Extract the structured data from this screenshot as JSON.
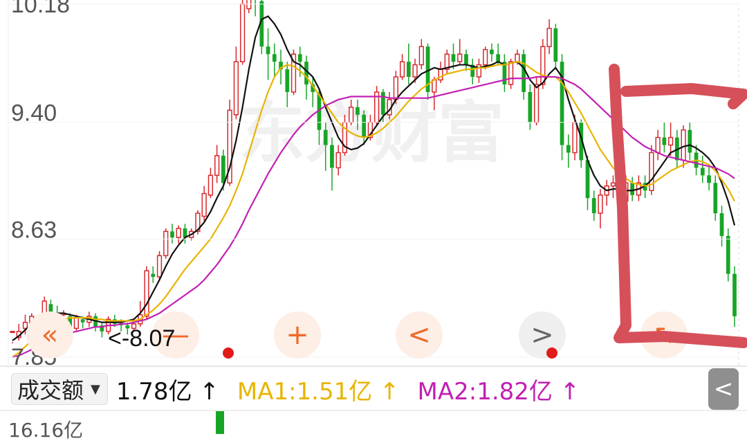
{
  "chart_data": {
    "type": "candlestick",
    "yticks": [
      "10.18",
      "9.40",
      "8.63",
      "7.85"
    ],
    "ylim": [
      7.85,
      10.18
    ],
    "watermark": "东方财富",
    "candles": [
      [
        8.02,
        8.02,
        7.95,
        7.94
      ],
      [
        7.98,
        8.02,
        8.07,
        7.96
      ],
      [
        8.04,
        8.08,
        8.13,
        8.0
      ],
      [
        8.06,
        8.12,
        8.14,
        8.02
      ],
      [
        8.04,
        8.03,
        8.13,
        8.0
      ],
      [
        8.1,
        8.22,
        8.25,
        8.08
      ],
      [
        8.2,
        8.14,
        8.23,
        8.1
      ],
      [
        8.13,
        8.12,
        8.19,
        8.08
      ],
      [
        8.13,
        8.14,
        8.16,
        8.06
      ],
      [
        8.12,
        8.04,
        8.14,
        8.02
      ],
      [
        8.04,
        8.11,
        8.13,
        8.02
      ],
      [
        8.1,
        8.08,
        8.12,
        8.04
      ],
      [
        8.08,
        8.12,
        8.15,
        8.05
      ],
      [
        8.12,
        8.05,
        8.14,
        8.02
      ],
      [
        8.06,
        8.02,
        8.08,
        7.98
      ],
      [
        8.02,
        8.1,
        8.12,
        8.0
      ],
      [
        8.1,
        8.07,
        8.13,
        8.05
      ],
      [
        8.07,
        8.06,
        8.1,
        8.02
      ],
      [
        8.06,
        8.04,
        8.08,
        8.0
      ],
      [
        8.04,
        8.07,
        8.1,
        8.02
      ],
      [
        8.07,
        8.13,
        8.22,
        8.05
      ],
      [
        8.12,
        8.42,
        8.45,
        8.1
      ],
      [
        8.4,
        8.38,
        8.45,
        8.34
      ],
      [
        8.38,
        8.52,
        8.55,
        8.35
      ],
      [
        8.52,
        8.68,
        8.7,
        8.5
      ],
      [
        8.68,
        8.64,
        8.73,
        8.6
      ],
      [
        8.64,
        8.7,
        8.72,
        8.6
      ],
      [
        8.7,
        8.64,
        8.73,
        8.6
      ],
      [
        8.64,
        8.68,
        8.7,
        8.62
      ],
      [
        8.68,
        8.8,
        8.82,
        8.66
      ],
      [
        8.78,
        8.93,
        8.98,
        8.75
      ],
      [
        8.92,
        9.05,
        9.1,
        8.9
      ],
      [
        9.05,
        9.18,
        9.25,
        9.0
      ],
      [
        9.18,
        9.0,
        9.22,
        8.95
      ],
      [
        9.0,
        9.48,
        9.55,
        8.98
      ],
      [
        9.45,
        9.8,
        9.9,
        9.42
      ],
      [
        9.8,
        10.18,
        10.3,
        9.78
      ],
      [
        10.15,
        10.25,
        10.32,
        10.12
      ],
      [
        10.25,
        10.22,
        10.3,
        10.1
      ],
      [
        10.2,
        9.9,
        10.25,
        9.85
      ],
      [
        9.9,
        9.85,
        10.02,
        9.68
      ],
      [
        9.85,
        9.8,
        9.92,
        9.7
      ],
      [
        9.8,
        9.75,
        9.88,
        9.65
      ],
      [
        9.75,
        9.6,
        9.8,
        9.5
      ],
      [
        9.6,
        9.85,
        9.88,
        9.58
      ],
      [
        9.85,
        9.8,
        9.9,
        9.7
      ],
      [
        9.8,
        9.65,
        9.84,
        9.55
      ],
      [
        9.65,
        9.6,
        9.7,
        9.5
      ],
      [
        9.6,
        9.35,
        9.62,
        9.25
      ],
      [
        9.35,
        9.25,
        9.4,
        9.08
      ],
      [
        9.25,
        9.1,
        9.3,
        8.95
      ],
      [
        9.1,
        9.2,
        9.25,
        9.05
      ],
      [
        9.2,
        9.4,
        9.45,
        9.18
      ],
      [
        9.4,
        9.5,
        9.55,
        9.38
      ],
      [
        9.5,
        9.45,
        9.55,
        9.35
      ],
      [
        9.45,
        9.3,
        9.48,
        9.25
      ],
      [
        9.3,
        9.4,
        9.45,
        9.28
      ],
      [
        9.4,
        9.6,
        9.64,
        9.38
      ],
      [
        9.6,
        9.45,
        9.62,
        9.4
      ],
      [
        9.45,
        9.55,
        9.6,
        9.42
      ],
      [
        9.55,
        9.7,
        9.74,
        9.52
      ],
      [
        9.7,
        9.8,
        9.85,
        9.68
      ],
      [
        9.8,
        9.7,
        9.92,
        9.65
      ],
      [
        9.7,
        9.78,
        9.82,
        9.66
      ],
      [
        9.78,
        9.9,
        9.95,
        9.75
      ],
      [
        9.9,
        9.6,
        9.92,
        9.55
      ],
      [
        9.6,
        9.68,
        9.7,
        9.48
      ],
      [
        9.68,
        9.75,
        9.8,
        9.66
      ],
      [
        9.75,
        9.85,
        9.88,
        9.72
      ],
      [
        9.85,
        9.8,
        9.92,
        9.75
      ],
      [
        9.8,
        9.85,
        9.95,
        9.78
      ],
      [
        9.85,
        9.78,
        9.88,
        9.74
      ],
      [
        9.78,
        9.7,
        9.82,
        9.65
      ],
      [
        9.7,
        9.78,
        9.82,
        9.66
      ],
      [
        9.78,
        9.88,
        9.9,
        9.75
      ],
      [
        9.88,
        9.85,
        9.92,
        9.8
      ],
      [
        9.85,
        9.8,
        9.92,
        9.78
      ],
      [
        9.8,
        9.65,
        9.85,
        9.6
      ],
      [
        9.65,
        9.8,
        9.82,
        9.62
      ],
      [
        9.8,
        9.85,
        9.88,
        9.78
      ],
      [
        9.85,
        9.6,
        9.88,
        9.55
      ],
      [
        9.6,
        9.4,
        9.65,
        9.35
      ],
      [
        9.4,
        9.65,
        9.7,
        9.38
      ],
      [
        9.65,
        9.9,
        9.95,
        9.62
      ],
      [
        9.9,
        10.02,
        10.08,
        9.85
      ],
      [
        10.02,
        9.8,
        10.05,
        9.75
      ],
      [
        9.8,
        9.25,
        9.85,
        9.15
      ],
      [
        9.25,
        9.2,
        9.32,
        9.1
      ],
      [
        9.2,
        9.4,
        9.45,
        9.15
      ],
      [
        9.4,
        9.15,
        9.42,
        9.1
      ],
      [
        9.15,
        8.9,
        9.18,
        8.82
      ],
      [
        8.9,
        8.8,
        8.95,
        8.75
      ],
      [
        8.8,
        8.92,
        8.96,
        8.7
      ],
      [
        8.92,
        8.98,
        9.02,
        8.85
      ],
      [
        8.98,
        9.0,
        9.05,
        8.9
      ],
      [
        9.0,
        8.88,
        9.02,
        8.85
      ],
      [
        8.88,
        9.0,
        9.05,
        8.86
      ],
      [
        9.0,
        8.92,
        9.04,
        8.88
      ],
      [
        8.92,
        9.0,
        9.05,
        8.88
      ],
      [
        9.0,
        8.95,
        9.05,
        8.9
      ],
      [
        8.95,
        9.2,
        9.25,
        8.92
      ],
      [
        9.2,
        9.3,
        9.35,
        9.15
      ],
      [
        9.3,
        9.25,
        9.4,
        9.2
      ],
      [
        9.25,
        9.3,
        9.4,
        9.18
      ],
      [
        9.3,
        9.15,
        9.35,
        9.1
      ],
      [
        9.15,
        9.35,
        9.38,
        9.1
      ],
      [
        9.35,
        9.2,
        9.4,
        9.15
      ],
      [
        9.2,
        9.1,
        9.25,
        9.05
      ],
      [
        9.1,
        9.05,
        9.18,
        9.0
      ],
      [
        9.05,
        9.0,
        9.12,
        8.95
      ],
      [
        9.0,
        8.8,
        9.05,
        8.75
      ],
      [
        8.8,
        8.65,
        8.85,
        8.58
      ],
      [
        8.65,
        8.4,
        8.7,
        8.35
      ],
      [
        8.4,
        8.12,
        8.45,
        8.05
      ]
    ],
    "ma_series": [
      {
        "color": "#111111",
        "values": [
          7.96,
          7.99,
          8.03,
          8.07,
          8.1,
          8.13,
          8.14,
          8.14,
          8.14,
          8.13,
          8.12,
          8.11,
          8.1,
          8.09,
          8.08,
          8.08,
          8.08,
          8.08,
          8.09,
          8.1,
          8.14,
          8.2,
          8.28,
          8.36,
          8.45,
          8.53,
          8.59,
          8.64,
          8.66,
          8.69,
          8.74,
          8.81,
          8.9,
          8.98,
          9.1,
          9.28,
          9.5,
          9.75,
          9.96,
          10.08,
          10.1,
          10.05,
          9.98,
          9.88,
          9.8,
          9.78,
          9.74,
          9.7,
          9.62,
          9.5,
          9.4,
          9.3,
          9.24,
          9.22,
          9.23,
          9.26,
          9.32,
          9.38,
          9.44,
          9.48,
          9.55,
          9.6,
          9.64,
          9.68,
          9.72,
          9.74,
          9.76,
          9.75,
          9.76,
          9.77,
          9.78,
          9.78,
          9.77,
          9.76,
          9.77,
          9.78,
          9.8,
          9.78,
          9.79,
          9.8,
          9.76,
          9.68,
          9.63,
          9.66,
          9.72,
          9.76,
          9.7,
          9.55,
          9.42,
          9.3,
          9.15,
          9.05,
          8.98,
          8.95,
          8.96,
          8.96,
          8.95,
          8.95,
          8.96,
          8.98,
          9.02,
          9.08,
          9.14,
          9.2,
          9.22,
          9.24,
          9.25,
          9.23,
          9.2,
          9.16,
          9.1,
          9.0,
          8.88,
          8.72
        ]
      },
      {
        "color": "#e8b400",
        "values": [
          7.85,
          7.88,
          7.92,
          7.96,
          8.0,
          8.04,
          8.07,
          8.09,
          8.1,
          8.11,
          8.11,
          8.11,
          8.11,
          8.1,
          8.1,
          8.09,
          8.09,
          8.09,
          8.09,
          8.09,
          8.1,
          8.13,
          8.16,
          8.2,
          8.25,
          8.31,
          8.37,
          8.43,
          8.48,
          8.53,
          8.58,
          8.63,
          8.7,
          8.77,
          8.85,
          8.95,
          9.06,
          9.2,
          9.34,
          9.48,
          9.6,
          9.7,
          9.76,
          9.78,
          9.77,
          9.74,
          9.7,
          9.64,
          9.58,
          9.52,
          9.46,
          9.4,
          9.36,
          9.33,
          9.31,
          9.3,
          9.31,
          9.33,
          9.36,
          9.4,
          9.44,
          9.49,
          9.54,
          9.58,
          9.62,
          9.65,
          9.68,
          9.7,
          9.72,
          9.73,
          9.74,
          9.75,
          9.75,
          9.76,
          9.76,
          9.77,
          9.78,
          9.78,
          9.79,
          9.8,
          9.79,
          9.76,
          9.73,
          9.71,
          9.7,
          9.7,
          9.66,
          9.6,
          9.53,
          9.46,
          9.38,
          9.3,
          9.22,
          9.16,
          9.1,
          9.06,
          9.03,
          9.0,
          8.99,
          8.98,
          8.99,
          9.02,
          9.05,
          9.08,
          9.1,
          9.12,
          9.14,
          9.15,
          9.14,
          9.12,
          9.08,
          9.02,
          8.96,
          8.88
        ]
      },
      {
        "color": "#c21fb3",
        "values": [
          7.85,
          7.86,
          7.88,
          7.9,
          7.92,
          7.94,
          7.96,
          7.98,
          8.0,
          8.01,
          8.02,
          8.03,
          8.04,
          8.05,
          8.05,
          8.06,
          8.06,
          8.07,
          8.07,
          8.08,
          8.09,
          8.1,
          8.12,
          8.14,
          8.17,
          8.2,
          8.23,
          8.26,
          8.29,
          8.32,
          8.36,
          8.41,
          8.46,
          8.52,
          8.58,
          8.65,
          8.73,
          8.82,
          8.9,
          8.98,
          9.06,
          9.13,
          9.2,
          9.26,
          9.32,
          9.37,
          9.41,
          9.45,
          9.48,
          9.51,
          9.53,
          9.55,
          9.56,
          9.57,
          9.57,
          9.57,
          9.57,
          9.57,
          9.57,
          9.56,
          9.56,
          9.56,
          9.56,
          9.56,
          9.56,
          9.56,
          9.57,
          9.58,
          9.59,
          9.6,
          9.61,
          9.62,
          9.63,
          9.64,
          9.65,
          9.66,
          9.67,
          9.68,
          9.69,
          9.69,
          9.69,
          9.69,
          9.7,
          9.7,
          9.7,
          9.7,
          9.69,
          9.67,
          9.65,
          9.62,
          9.58,
          9.54,
          9.5,
          9.46,
          9.42,
          9.38,
          9.34,
          9.3,
          9.27,
          9.24,
          9.22,
          9.2,
          9.18,
          9.17,
          9.16,
          9.15,
          9.14,
          9.13,
          9.12,
          9.11,
          9.1,
          9.08,
          9.06,
          9.03
        ]
      }
    ]
  },
  "readout": "<-8.07",
  "controls": {
    "back": "«",
    "zoom_out": "—",
    "zoom_in": "+",
    "prev": "<",
    "next": ">",
    "restore": "↖"
  },
  "volume": {
    "selector": "成交额",
    "value": "1.78亿 ↑",
    "ma1": "MA1:1.51亿 ↑",
    "ma2": "MA2:1.82亿 ↑",
    "axis_top": "16.16亿",
    "collapse": "<"
  },
  "colors": {
    "up": "#d7272b",
    "down": "#18a527",
    "annotation": "#d6505a"
  }
}
